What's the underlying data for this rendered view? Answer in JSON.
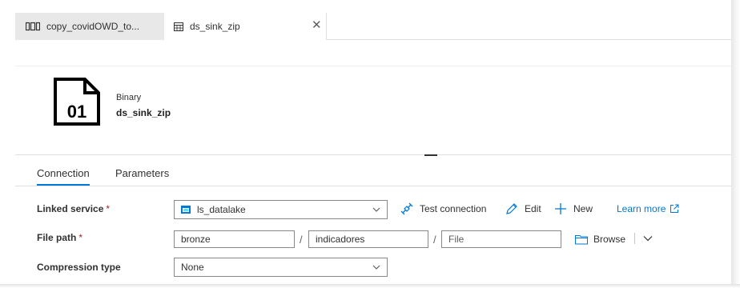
{
  "tabs": [
    {
      "label": "copy_covidOWD_to...",
      "icon": "pipeline-icon",
      "active": false
    },
    {
      "label": "ds_sink_zip",
      "icon": "dataset-table-icon",
      "active": true,
      "close": "✕"
    }
  ],
  "dataset": {
    "icon_text": "01",
    "type": "Binary",
    "name": "ds_sink_zip"
  },
  "subtabs": [
    {
      "label": "Connection",
      "active": true
    },
    {
      "label": "Parameters",
      "active": false
    }
  ],
  "form": {
    "linked_service": {
      "label": "Linked service",
      "required": "*",
      "value": "ls_datalake",
      "actions": {
        "test_connection": "Test connection",
        "edit": "Edit",
        "new": "New",
        "learn_more": "Learn more"
      }
    },
    "file_path": {
      "label": "File path",
      "required": "*",
      "container": "bronze",
      "directory": "indicadores",
      "file_placeholder": "File",
      "separator": "/",
      "browse": "Browse"
    },
    "compression": {
      "label": "Compression type",
      "value": "None"
    }
  },
  "colors": {
    "accent": "#0078d4",
    "required": "#a4262c",
    "text": "#323130",
    "border": "#8a8886"
  }
}
